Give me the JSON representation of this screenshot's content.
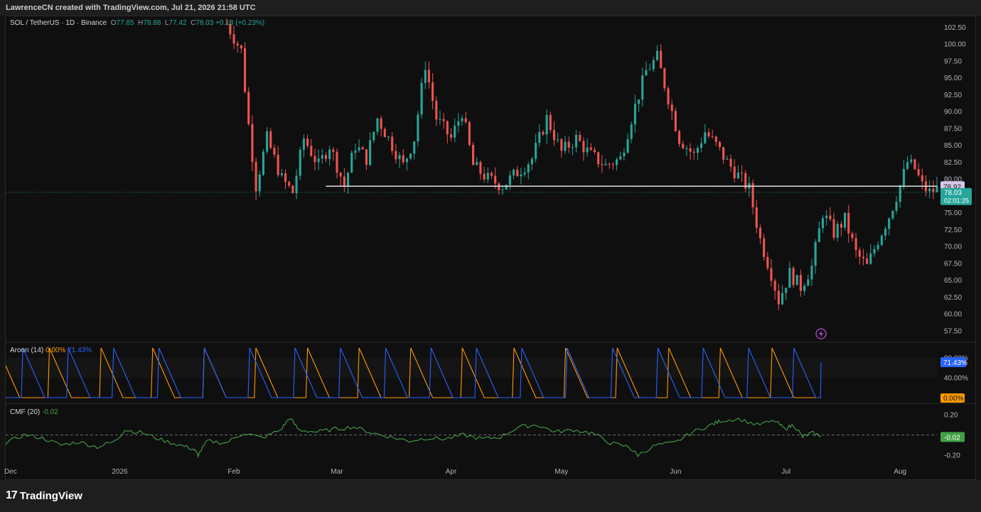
{
  "header": {
    "credit": "LawrenceCN created with TradingView.com, Jul 21, 2026 21:58 UTC"
  },
  "footer": {
    "brand": "TradingView",
    "logo_glyph": "17"
  },
  "price_pane": {
    "symbol": "SOL / TetherUS · 1D · Binance",
    "ohlc": {
      "O": "77.85",
      "H": "78.88",
      "L": "77.42",
      "C": "78.03",
      "chg": "+0.18",
      "chg_pct": "(+0.23%)"
    },
    "y_ticks": [
      "102.50",
      "100.00",
      "97.50",
      "95.00",
      "92.50",
      "90.00",
      "87.50",
      "85.00",
      "82.50",
      "80.00",
      "75.00",
      "72.50",
      "70.00",
      "67.50",
      "65.00",
      "62.50",
      "60.00",
      "57.50"
    ],
    "horizontal_line": {
      "label": "78.92",
      "value": 78.92
    },
    "last_price": {
      "label": "78.03",
      "countdown": "02:01:25",
      "value": 78.03
    }
  },
  "aroon_pane": {
    "title": "Aroon (14)",
    "down_value": "0.00%",
    "up_value": "71.43%",
    "y_ticks": [
      "80.00%",
      "40.00%"
    ]
  },
  "cmf_pane": {
    "title": "CMF (20)",
    "value": "-0.02",
    "y_ticks": [
      "0.20",
      "-0.20"
    ]
  },
  "x_axis": {
    "ticks": [
      "Dec",
      "2026",
      "Feb",
      "Mar",
      "Apr",
      "May",
      "Jun",
      "Jul",
      "Aug"
    ]
  },
  "colors": {
    "up": "#26a69a",
    "down": "#ef5350",
    "aroon_up": "#2962ff",
    "aroon_down": "#ff9800",
    "cmf": "#43a047",
    "hline": "#e0e0e0"
  },
  "chart_data": [
    {
      "type": "candlestick",
      "title": "SOL / TetherUS · 1D · Binance",
      "ylim": [
        56,
        104
      ],
      "x_start": "2025-12-01",
      "x_end": "2026-08-11",
      "x_tick_dates": [
        "2025-12-01",
        "2026-01-01",
        "2026-02-01",
        "2026-03-01",
        "2026-04-01",
        "2026-05-01",
        "2026-06-01",
        "2026-07-01",
        "2026-08-01"
      ],
      "waypoints": [
        [
          "2026-01-30",
          103.0
        ],
        [
          "2026-02-03",
          99.0
        ],
        [
          "2026-02-05",
          88.0
        ],
        [
          "2026-02-07",
          79.0
        ],
        [
          "2026-02-10",
          86.0
        ],
        [
          "2026-02-14",
          80.0
        ],
        [
          "2026-02-17",
          78.0
        ],
        [
          "2026-02-20",
          86.0
        ],
        [
          "2026-02-24",
          82.0
        ],
        [
          "2026-02-27",
          85.0
        ],
        [
          "2026-03-03",
          79.0
        ],
        [
          "2026-03-06",
          85.0
        ],
        [
          "2026-03-09",
          83.0
        ],
        [
          "2026-03-12",
          89.0
        ],
        [
          "2026-03-16",
          85.0
        ],
        [
          "2026-03-19",
          82.0
        ],
        [
          "2026-03-22",
          86.0
        ],
        [
          "2026-03-25",
          97.0
        ],
        [
          "2026-03-28",
          89.0
        ],
        [
          "2026-04-01",
          86.0
        ],
        [
          "2026-04-04",
          90.0
        ],
        [
          "2026-04-07",
          82.0
        ],
        [
          "2026-04-11",
          80.0
        ],
        [
          "2026-04-15",
          79.0
        ],
        [
          "2026-04-19",
          81.0
        ],
        [
          "2026-04-23",
          83.0
        ],
        [
          "2026-04-27",
          89.0
        ],
        [
          "2026-05-01",
          84.0
        ],
        [
          "2026-05-05",
          86.0
        ],
        [
          "2026-05-09",
          83.5
        ],
        [
          "2026-05-13",
          82.0
        ],
        [
          "2026-05-17",
          83.0
        ],
        [
          "2026-05-20",
          89.0
        ],
        [
          "2026-05-24",
          96.0
        ],
        [
          "2026-05-27",
          98.0
        ],
        [
          "2026-05-30",
          92.0
        ],
        [
          "2026-06-02",
          86.0
        ],
        [
          "2026-06-06",
          83.5
        ],
        [
          "2026-06-09",
          87.0
        ],
        [
          "2026-06-12",
          85.0
        ],
        [
          "2026-06-15",
          82.5
        ],
        [
          "2026-06-18",
          80.5
        ],
        [
          "2026-06-21",
          78.5
        ],
        [
          "2026-06-24",
          71.0
        ],
        [
          "2026-06-27",
          66.0
        ],
        [
          "2026-06-29",
          62.0
        ],
        [
          "2026-07-02",
          66.0
        ],
        [
          "2026-07-05",
          64.0
        ],
        [
          "2026-07-08",
          67.0
        ],
        [
          "2026-07-11",
          75.0
        ],
        [
          "2026-07-14",
          72.0
        ],
        [
          "2026-07-17",
          74.0
        ],
        [
          "2026-07-20",
          69.0
        ],
        [
          "2026-07-23",
          67.0
        ],
        [
          "2026-07-26",
          71.0
        ],
        [
          "2026-07-29",
          74.5
        ],
        [
          "2026-08-01",
          79.0
        ],
        [
          "2026-08-03",
          82.5
        ],
        [
          "2026-08-05",
          81.5
        ],
        [
          "2026-08-07",
          79.0
        ],
        [
          "2026-08-09",
          78.0
        ],
        [
          "2026-08-11",
          78.5
        ]
      ]
    },
    {
      "type": "line",
      "title": "Aroon (14)",
      "ylim": [
        0,
        100
      ],
      "series": [
        {
          "name": "Aroon Down",
          "last": 0.0
        },
        {
          "name": "Aroon Up",
          "last": 71.43
        }
      ]
    },
    {
      "type": "line",
      "title": "CMF (20)",
      "ylim": [
        -0.3,
        0.3
      ],
      "waypoints": [
        [
          0.0,
          -0.08
        ],
        [
          0.02,
          0.0
        ],
        [
          0.04,
          -0.03
        ],
        [
          0.06,
          -0.1
        ],
        [
          0.08,
          -0.07
        ],
        [
          0.1,
          -0.12
        ],
        [
          0.12,
          -0.06
        ],
        [
          0.13,
          0.05
        ],
        [
          0.15,
          0.02
        ],
        [
          0.17,
          -0.05
        ],
        [
          0.19,
          -0.1
        ],
        [
          0.205,
          -0.14
        ],
        [
          0.21,
          -0.2
        ],
        [
          0.22,
          -0.06
        ],
        [
          0.24,
          -0.08
        ],
        [
          0.26,
          0.02
        ],
        [
          0.28,
          -0.03
        ],
        [
          0.3,
          0.05
        ],
        [
          0.31,
          0.17
        ],
        [
          0.32,
          0.05
        ],
        [
          0.34,
          0.03
        ],
        [
          0.36,
          0.06
        ],
        [
          0.38,
          0.08
        ],
        [
          0.4,
          0.02
        ],
        [
          0.42,
          -0.02
        ],
        [
          0.44,
          -0.06
        ],
        [
          0.46,
          -0.03
        ],
        [
          0.48,
          -0.04
        ],
        [
          0.5,
          0.0
        ],
        [
          0.52,
          -0.04
        ],
        [
          0.54,
          -0.02
        ],
        [
          0.56,
          0.08
        ],
        [
          0.58,
          0.1
        ],
        [
          0.6,
          0.03
        ],
        [
          0.62,
          0.05
        ],
        [
          0.64,
          0.02
        ],
        [
          0.66,
          -0.08
        ],
        [
          0.68,
          -0.12
        ],
        [
          0.69,
          -0.2
        ],
        [
          0.71,
          -0.1
        ],
        [
          0.73,
          -0.08
        ],
        [
          0.75,
          0.03
        ],
        [
          0.77,
          0.1
        ],
        [
          0.78,
          0.14
        ],
        [
          0.8,
          0.16
        ],
        [
          0.82,
          0.1
        ],
        [
          0.84,
          0.14
        ],
        [
          0.85,
          0.06
        ],
        [
          0.86,
          0.1
        ],
        [
          0.87,
          -0.02
        ],
        [
          0.88,
          0.02
        ],
        [
          0.89,
          -0.01
        ]
      ]
    }
  ]
}
